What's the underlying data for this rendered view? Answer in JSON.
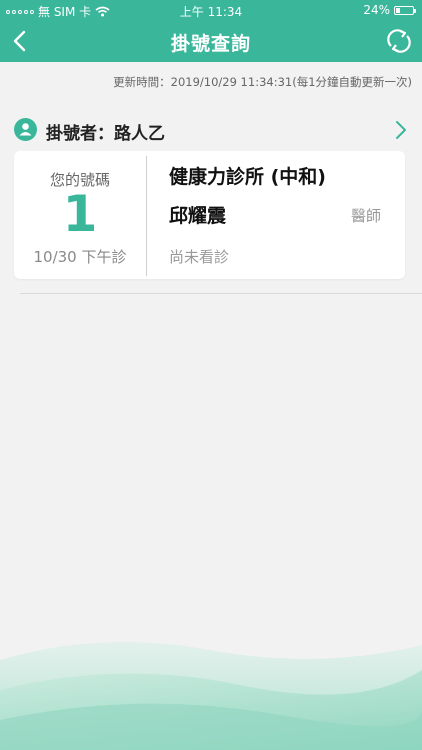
{
  "status_bar": {
    "carrier": "無 SIM 卡",
    "time": "上午 11:34",
    "battery": "24%",
    "battery_level": 0.24
  },
  "nav": {
    "title": "掛號查詢",
    "back_icon": "chevron-left-icon",
    "refresh_icon": "refresh-icon"
  },
  "updated_text": "更新時間：2019/10/29 11:34:31(每1分鐘自動更新一次)",
  "registrant": {
    "label": "掛號者：路人乙",
    "icon": "person-icon"
  },
  "appointment": {
    "number_label": "您的號碼",
    "number": "1",
    "session": "10/30 下午診",
    "clinic": "健康力診所 (中和)",
    "doctor": "邱耀震",
    "doctor_title": "醫師",
    "status": "尚未看診"
  },
  "colors": {
    "accent": "#3ab79b",
    "background": "#f2f2f2"
  }
}
